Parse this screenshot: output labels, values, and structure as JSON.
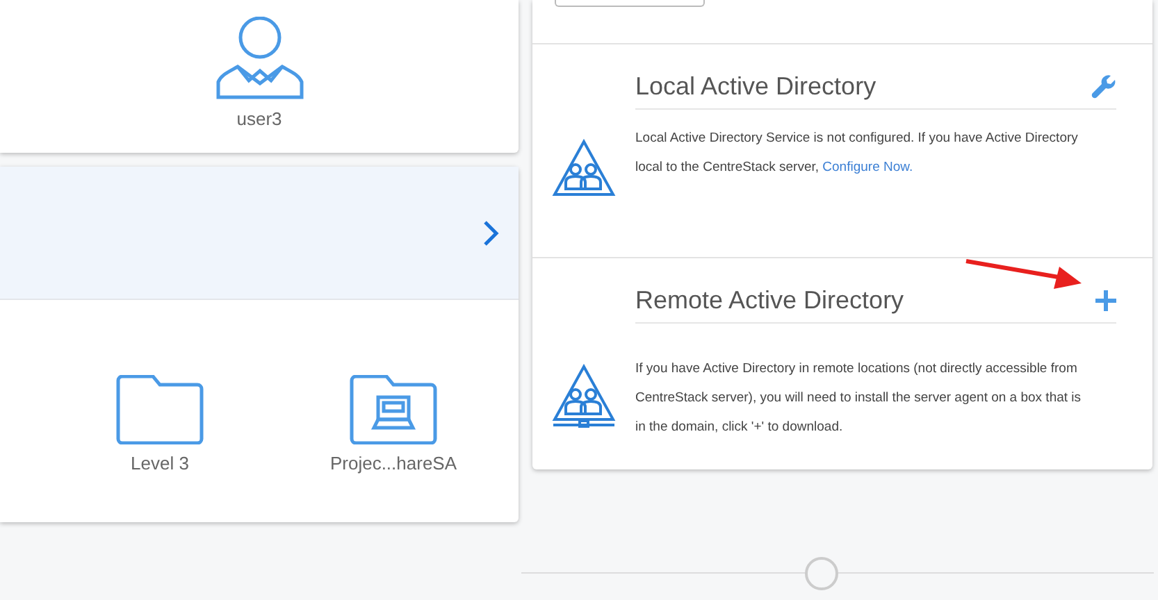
{
  "user_card": {
    "label": "user3"
  },
  "folder_card": {
    "folders": [
      {
        "kind": "folder",
        "label": "Level 3"
      },
      {
        "kind": "shared",
        "label": "Projec...hareSA"
      }
    ]
  },
  "directory_panel": {
    "sections": [
      {
        "kind": "local",
        "title": "Local Active Directory",
        "action": {
          "kind": "wrench"
        },
        "text": "Local Active Directory Service is not configured. If you have Active Directory local to the CentreStack server, ",
        "link": "Configure Now."
      },
      {
        "kind": "remote",
        "title": "Remote Active Directory",
        "action": {
          "kind": "plus"
        },
        "text": "If you have Active Directory in remote locations (not directly accessible from CentreStack server), you will need to install the server agent on a box that is in the domain, click '+' to download."
      }
    ]
  }
}
